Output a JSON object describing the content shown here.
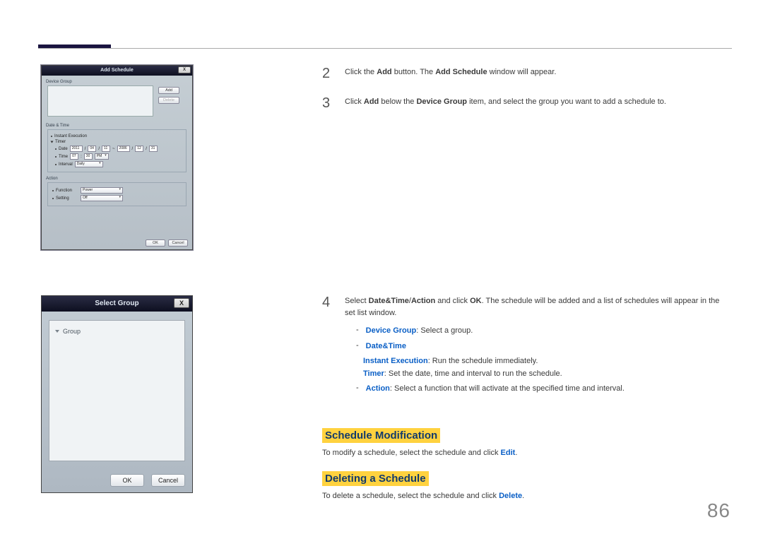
{
  "page_number": "86",
  "add_schedule": {
    "title": "Add Schedule",
    "close": "X",
    "device_group_label": "Device Group",
    "btn_add": "Add",
    "btn_delete": "Delete",
    "date_time_label": "Date & Time",
    "instant_execution": "Instant Execution",
    "timer": "Timer",
    "date_label": "Date",
    "date_from_y": "2011",
    "date_from_m": "04",
    "date_from_d": "11",
    "date_to_y": "2086",
    "date_to_m": "12",
    "date_to_d": "31",
    "time_label": "Time",
    "time_h": "07",
    "time_m": "30",
    "time_ap": "PM",
    "interval_label": "Interval",
    "interval_val": "Daily",
    "action_label": "Action",
    "function_label": "Function",
    "function_val": "Power",
    "setting_label": "Setting",
    "setting_val": "Off",
    "ok": "OK",
    "cancel": "Cancel"
  },
  "select_group": {
    "title": "Select Group",
    "close": "X",
    "root": "Group",
    "ok": "OK",
    "cancel": "Cancel"
  },
  "step2": {
    "num": "2",
    "t1": "Click the ",
    "b1": "Add",
    "t2": " button. The ",
    "b2": "Add Schedule",
    "t3": " window will appear."
  },
  "step3": {
    "num": "3",
    "t1": "Click ",
    "b1": "Add",
    "t2": " below the ",
    "b2": "Device Group",
    "t3": " item, and select the group you want to add a schedule to."
  },
  "step4": {
    "num": "4",
    "t1": "Select ",
    "b1": "Date&Time",
    "t2": "/",
    "b2": "Action",
    "t3": " and click ",
    "b3": "OK",
    "t4": ". The schedule will be added and a list of schedules will appear in the set list window."
  },
  "b_dg": {
    "label": "Device Group",
    "text": ": Select a group."
  },
  "b_dt": {
    "label": "Date&Time"
  },
  "b_ie": {
    "label": "Instant Execution",
    "text": ": Run the schedule immediately."
  },
  "b_tm": {
    "label": "Timer",
    "text": ": Set the date, time and interval to run the schedule."
  },
  "b_ac": {
    "label": "Action",
    "text": ": Select a function that will activate at the specified time and interval."
  },
  "mod": {
    "heading": "Schedule Modification",
    "t1": "To modify a schedule, select the schedule and click ",
    "b1": "Edit",
    "t2": "."
  },
  "del": {
    "heading": "Deleting a Schedule",
    "t1": "To delete a schedule, select the schedule and click ",
    "b1": "Delete",
    "t2": "."
  }
}
